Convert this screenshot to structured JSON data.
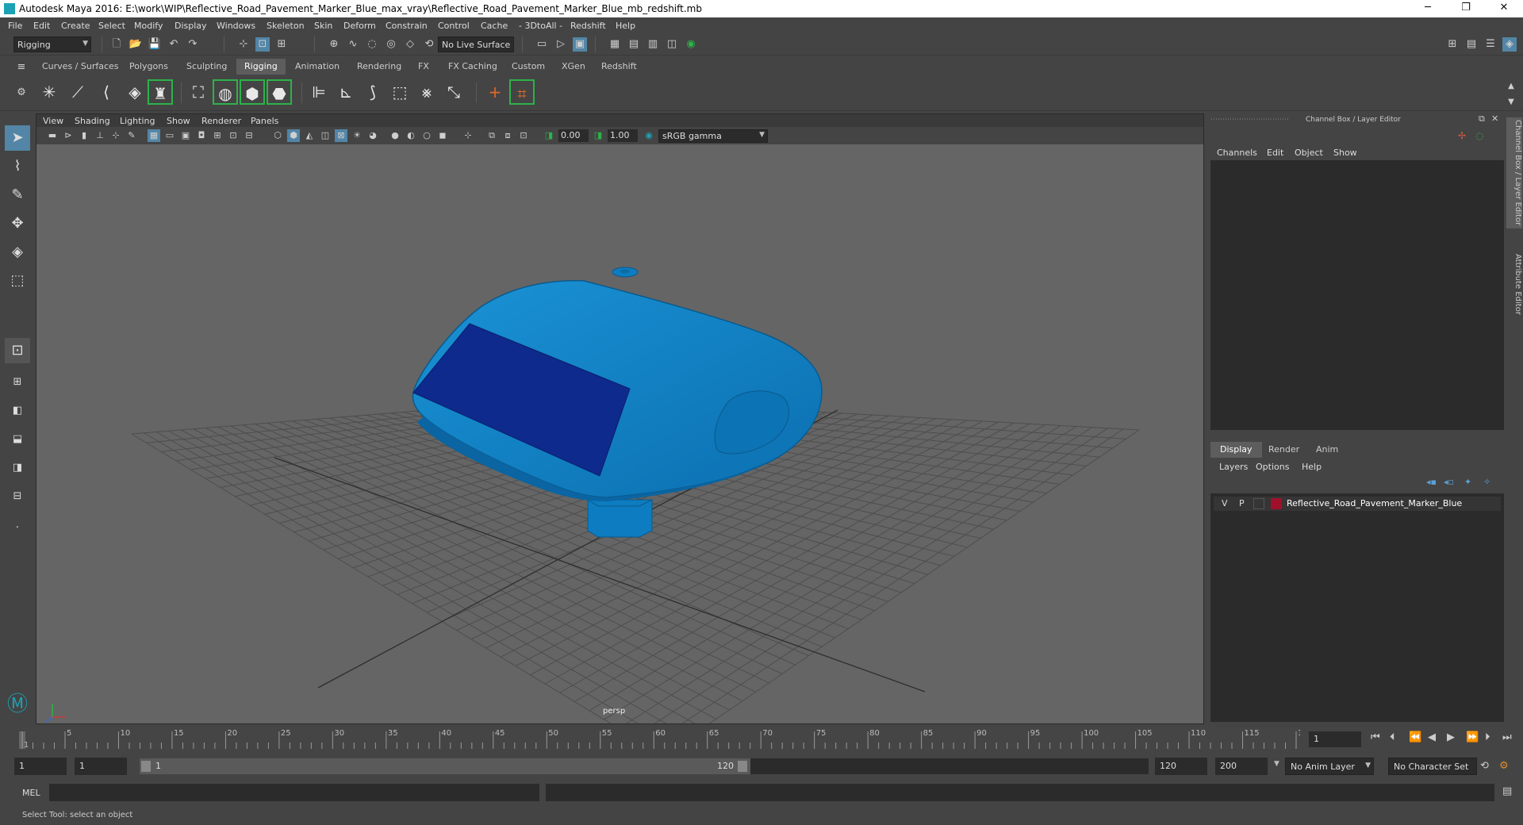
{
  "window": {
    "title": "Autodesk Maya 2016: E:\\work\\WIP\\Reflective_Road_Pavement_Marker_Blue_max_vray\\Reflective_Road_Pavement_Marker_Blue_mb_redshift.mb",
    "controls": [
      "─",
      "❐",
      "✕"
    ]
  },
  "menubar": [
    "File",
    "Edit",
    "Create",
    "Select",
    "Modify",
    "Display",
    "Windows",
    "Skeleton",
    "Skin",
    "Deform",
    "Constrain",
    "Control",
    "Cache",
    "- 3DtoAll -",
    "Redshift",
    "Help"
  ],
  "statusline": {
    "menuset": "Rigging",
    "live_surface": "No Live Surface"
  },
  "shelf": {
    "tabs": [
      "Curves / Surfaces",
      "Polygons",
      "Sculpting",
      "Rigging",
      "Animation",
      "Rendering",
      "FX",
      "FX Caching",
      "Custom",
      "XGen",
      "Redshift"
    ],
    "active_tab": "Rigging"
  },
  "panel": {
    "menus": [
      "View",
      "Shading",
      "Lighting",
      "Show",
      "Renderer",
      "Panels"
    ],
    "exposure": "0.00",
    "gamma": "1.00",
    "color_space": "sRGB gamma",
    "camera_label": "persp"
  },
  "channel_box": {
    "title": "Channel Box / Layer Editor",
    "menus": [
      "Channels",
      "Edit",
      "Object",
      "Show"
    ],
    "layer_tabs": [
      "Display",
      "Render",
      "Anim"
    ],
    "active_layer_tab": "Display",
    "layer_menus": [
      "Layers",
      "Options",
      "Help"
    ],
    "layer": {
      "v": "V",
      "p": "P",
      "color": "#a0102a",
      "name": "Reflective_Road_Pavement_Marker_Blue"
    }
  },
  "side_tabs": [
    "Channel Box / Layer Editor",
    "Attribute Editor"
  ],
  "timeline": {
    "ticks": [
      "1",
      "5",
      "10",
      "15",
      "20",
      "25",
      "30",
      "35",
      "40",
      "45",
      "50",
      "55",
      "60",
      "65",
      "70",
      "75",
      "80",
      "85",
      "90",
      "95",
      "100",
      "105",
      "110",
      "115",
      "120"
    ],
    "current_frame": "1"
  },
  "range": {
    "start": "1",
    "anim_start": "1",
    "slider_start": "1",
    "slider_end": "120",
    "range_end": "120",
    "anim_end": "200",
    "anim_layer": "No Anim Layer",
    "character_set": "No Character Set"
  },
  "command_line": {
    "label": "MEL"
  },
  "help_line": "Select Tool: select an object",
  "colors": {
    "model_blue": "#0d7cc0",
    "reflector_blue": "#0e2a8c",
    "viewport_bg": "#656565",
    "selected_tool": "#5285a6"
  }
}
